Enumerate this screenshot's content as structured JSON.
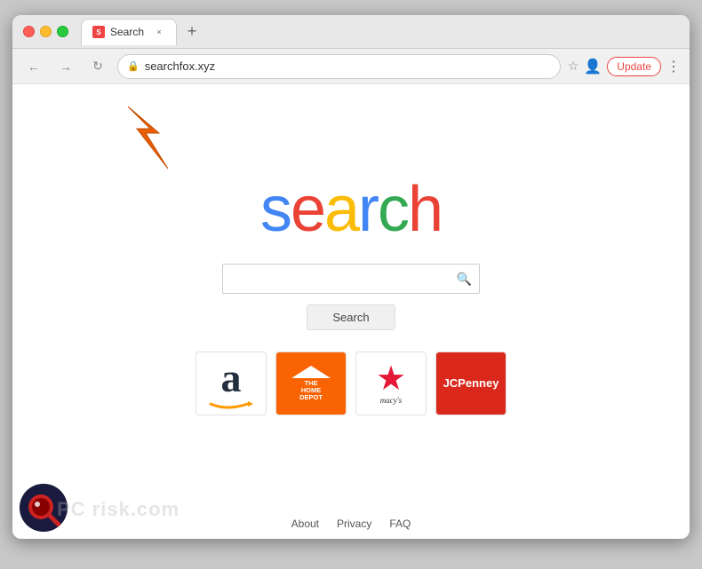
{
  "browser": {
    "title": "Search",
    "url": "searchfox.xyz",
    "tab_close": "×",
    "new_tab": "+",
    "update_btn": "Update",
    "nav": {
      "back": "←",
      "forward": "→",
      "refresh": "↻"
    }
  },
  "page": {
    "logo": {
      "s": "s",
      "e": "e",
      "a": "a",
      "r": "r",
      "c": "c",
      "h": "h"
    },
    "search_placeholder": "",
    "search_button": "Search",
    "footer": {
      "about": "About",
      "privacy": "Privacy",
      "faq": "FAQ"
    },
    "bookmarks": [
      {
        "name": "Amazon",
        "id": "amazon"
      },
      {
        "name": "The Home Depot",
        "id": "homedepot"
      },
      {
        "name": "Macy's",
        "id": "macys"
      },
      {
        "name": "JCPenney",
        "id": "jcpenney"
      }
    ]
  }
}
